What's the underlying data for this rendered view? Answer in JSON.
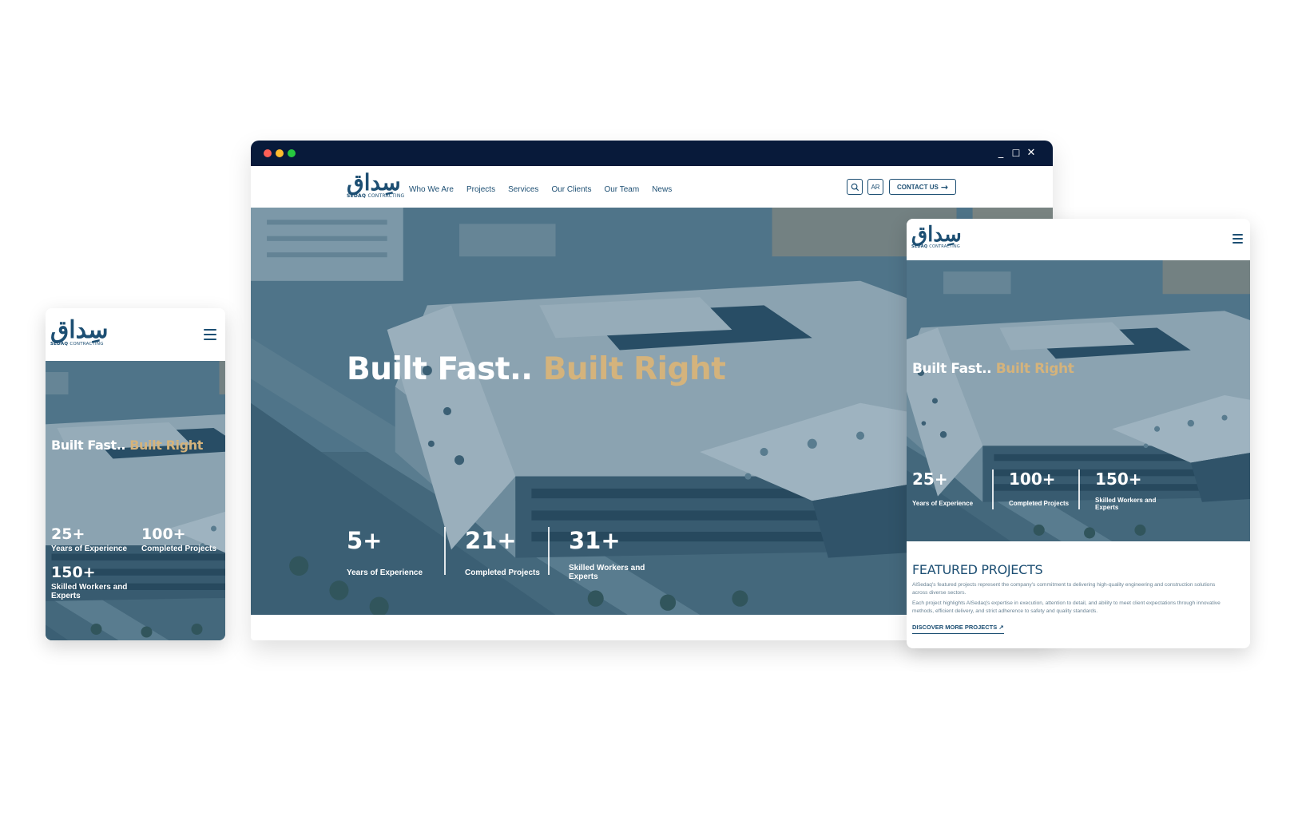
{
  "brand": {
    "logo_mark": "سِداق",
    "logo_sub": "SEDAQ",
    "logo_tag": "CONTRACTING"
  },
  "colors": {
    "navy": "#081a3a",
    "brand_blue": "#1d4f73",
    "gold": "#d4b37c",
    "dot_red": "#ff5f56",
    "dot_yellow": "#ffbd2e",
    "dot_green": "#27c93f"
  },
  "hero": {
    "title_part1": "Built Fast..",
    "title_part2": "Built Right"
  },
  "desktop": {
    "window_controls": {
      "minimize": "minimize-icon",
      "maximize": "maximize-icon",
      "close": "close-icon"
    },
    "nav_items": [
      {
        "label": "Who We Are"
      },
      {
        "label": "Projects"
      },
      {
        "label": "Services"
      },
      {
        "label": "Our Clients"
      },
      {
        "label": "Our Team"
      },
      {
        "label": "News"
      }
    ],
    "search_icon": "search-icon",
    "lang_label": "AR",
    "contact_label": "CONTACT US",
    "contact_arrow": "arrow-right-icon",
    "stats": [
      {
        "value": "5+",
        "label": "Years of Experience"
      },
      {
        "value": "21+",
        "label": "Completed Projects"
      },
      {
        "value": "31+",
        "label": "Skilled Workers and Experts"
      }
    ]
  },
  "tablet": {
    "menu_icon": "hamburger-icon",
    "stats": [
      {
        "value": "25+",
        "label": "Years of Experience"
      },
      {
        "value": "100+",
        "label": "Completed Projects"
      },
      {
        "value": "150+",
        "label": "Skilled Workers and Experts"
      }
    ],
    "featured": {
      "heading": "FEATURED PROJECTS",
      "paragraph1": "AlSedaq's featured projects represent the company's commitment to delivering high-quality engineering and construction solutions across diverse sectors.",
      "paragraph2": "Each project highlights AlSedaq's expertise in execution, attention to detail, and ability to meet client expectations through innovative methods, efficient delivery, and strict adherence to safety and quality standards.",
      "discover_label": "DISCOVER MORE PROJECTS ↗"
    }
  },
  "phone": {
    "menu_icon": "hamburger-icon",
    "stats": [
      {
        "value": "25+",
        "label": "Years of Experience"
      },
      {
        "value": "100+",
        "label": "Completed Projects"
      },
      {
        "value": "150+",
        "label": "Skilled Workers and Experts"
      }
    ]
  }
}
